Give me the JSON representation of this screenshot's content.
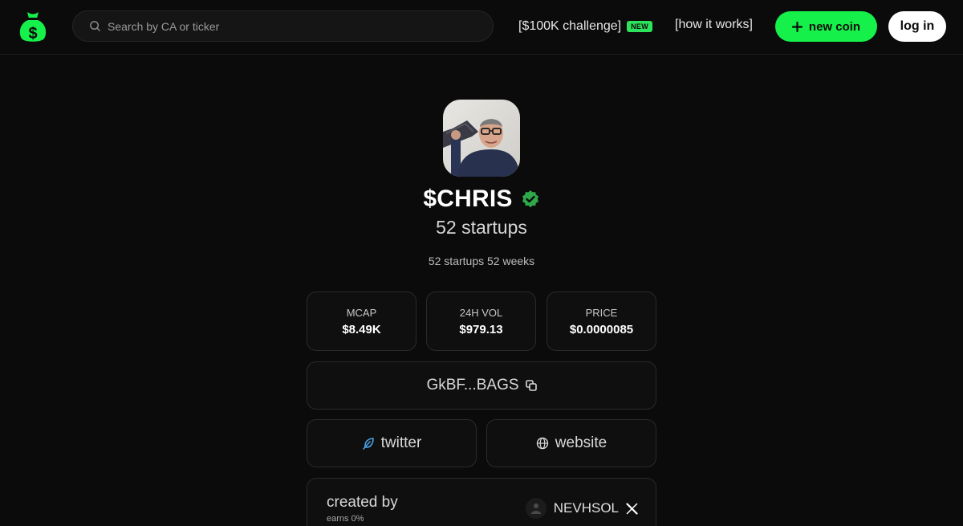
{
  "header": {
    "search_placeholder": "Search by CA or ticker",
    "challenge_label": "[$100K challenge]",
    "challenge_badge": "NEW",
    "how_label": "[how it works]",
    "new_coin_label": "new coin",
    "login_label": "log in"
  },
  "coin": {
    "ticker": "$CHRIS",
    "name": "52 startups",
    "description": "52 startups 52 weeks",
    "verified": true
  },
  "stats": [
    {
      "label": "MCAP",
      "value": "$8.49K"
    },
    {
      "label": "24H VOL",
      "value": "$979.13"
    },
    {
      "label": "PRICE",
      "value": "$0.0000085"
    }
  ],
  "contract": {
    "short": "GkBF...BAGS"
  },
  "links": {
    "twitter": "twitter",
    "website": "website"
  },
  "creator": {
    "label": "created by",
    "earns": "earns 0%",
    "name": "NEVHSOL"
  },
  "colors": {
    "accent": "#16f04a",
    "background": "#0b0b0b",
    "verified": "#2fa84a"
  }
}
